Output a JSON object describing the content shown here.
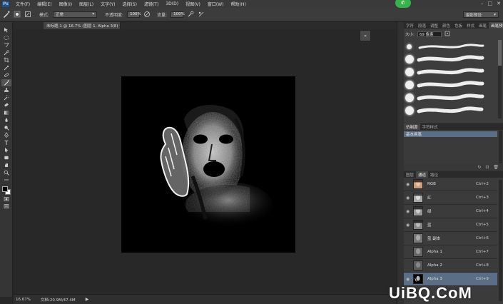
{
  "menubar": {
    "logo": "Ps",
    "items": [
      "文件(F)",
      "编辑(E)",
      "图像(I)",
      "图层(L)",
      "文字(Y)",
      "选择(S)",
      "滤镜(T)",
      "3D(D)",
      "视图(V)",
      "窗口(W)",
      "帮助(H)"
    ],
    "window_controls": [
      "–",
      "□",
      "✕"
    ]
  },
  "optbar": {
    "mode_label": "模式:",
    "mode_value": "正常",
    "opacity_label": "不透明度:",
    "opacity_value": "100%",
    "flow_label": "流量:",
    "flow_value": "100%",
    "workspace": "摄影预设"
  },
  "document": {
    "tab_title": "未标题-1 @ 16.7% (图层 1, Alpha 3/8) *",
    "tab_close": "×",
    "collapse_label": "«"
  },
  "status": {
    "zoom": "16.67%",
    "doc_info": "文档:20.9M/47.4M",
    "arrow": "▶"
  },
  "brush_panel": {
    "tabs": [
      "字符",
      "段落",
      "调整",
      "颜色",
      "色板",
      "样式",
      "画笔",
      "画笔预设"
    ],
    "active_tab_index": 7,
    "size_label": "大小:",
    "size_value": "69 像素"
  },
  "presets_panel": {
    "tabs": [
      "仿制源",
      "字符样式"
    ],
    "item": "基本画笔",
    "footer_icons": [
      "↻",
      "⊡",
      "🗑"
    ]
  },
  "channels_panel": {
    "tabs": [
      "图层",
      "通道",
      "路径"
    ],
    "active_tab_index": 1,
    "channels": [
      {
        "name": "RGB",
        "shortcut": "Ctrl+2",
        "visible": true,
        "selected": false
      },
      {
        "name": "红",
        "shortcut": "Ctrl+3",
        "visible": true,
        "selected": false
      },
      {
        "name": "绿",
        "shortcut": "Ctrl+4",
        "visible": true,
        "selected": false
      },
      {
        "name": "蓝",
        "shortcut": "Ctrl+5",
        "visible": true,
        "selected": false
      },
      {
        "name": "蓝 副本",
        "shortcut": "Ctrl+6",
        "visible": false,
        "selected": false
      },
      {
        "name": "Alpha 1",
        "shortcut": "Ctrl+7",
        "visible": false,
        "selected": false
      },
      {
        "name": "Alpha 2",
        "shortcut": "Ctrl+8",
        "visible": false,
        "selected": false
      },
      {
        "name": "Alpha 3",
        "shortcut": "Ctrl+9",
        "visible": true,
        "selected": true
      }
    ]
  },
  "watermark": "UiBQ.CoM",
  "colors": {
    "selection": "#5a6f86",
    "panel": "#3b3b3b",
    "canvas_bg": "#282828"
  }
}
